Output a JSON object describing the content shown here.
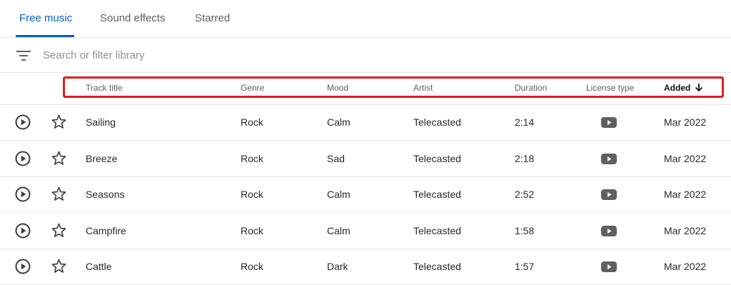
{
  "tabs": [
    {
      "label": "Free music",
      "active": true
    },
    {
      "label": "Sound effects",
      "active": false
    },
    {
      "label": "Starred",
      "active": false
    }
  ],
  "search": {
    "placeholder": "Search or filter library",
    "value": "",
    "icon": "filter-icon"
  },
  "columns": {
    "track_title": "Track title",
    "genre": "Genre",
    "mood": "Mood",
    "artist": "Artist",
    "duration": "Duration",
    "license_type": "License type",
    "added": "Added"
  },
  "sort": {
    "column": "Added",
    "direction": "descending",
    "icon": "arrow-down-icon"
  },
  "highlight_color": "#e02020",
  "accent_color": "#065fd4",
  "tracks": [
    {
      "title": "Sailing",
      "genre": "Rock",
      "mood": "Calm",
      "artist": "Telecasted",
      "duration": "2:14",
      "license_icon": "youtube-icon",
      "added": "Mar 2022"
    },
    {
      "title": "Breeze",
      "genre": "Rock",
      "mood": "Sad",
      "artist": "Telecasted",
      "duration": "2:18",
      "license_icon": "youtube-icon",
      "added": "Mar 2022"
    },
    {
      "title": "Seasons",
      "genre": "Rock",
      "mood": "Calm",
      "artist": "Telecasted",
      "duration": "2:52",
      "license_icon": "youtube-icon",
      "added": "Mar 2022"
    },
    {
      "title": "Campfire",
      "genre": "Rock",
      "mood": "Calm",
      "artist": "Telecasted",
      "duration": "1:58",
      "license_icon": "youtube-icon",
      "added": "Mar 2022"
    },
    {
      "title": "Cattle",
      "genre": "Rock",
      "mood": "Dark",
      "artist": "Telecasted",
      "duration": "1:57",
      "license_icon": "youtube-icon",
      "added": "Mar 2022"
    }
  ]
}
